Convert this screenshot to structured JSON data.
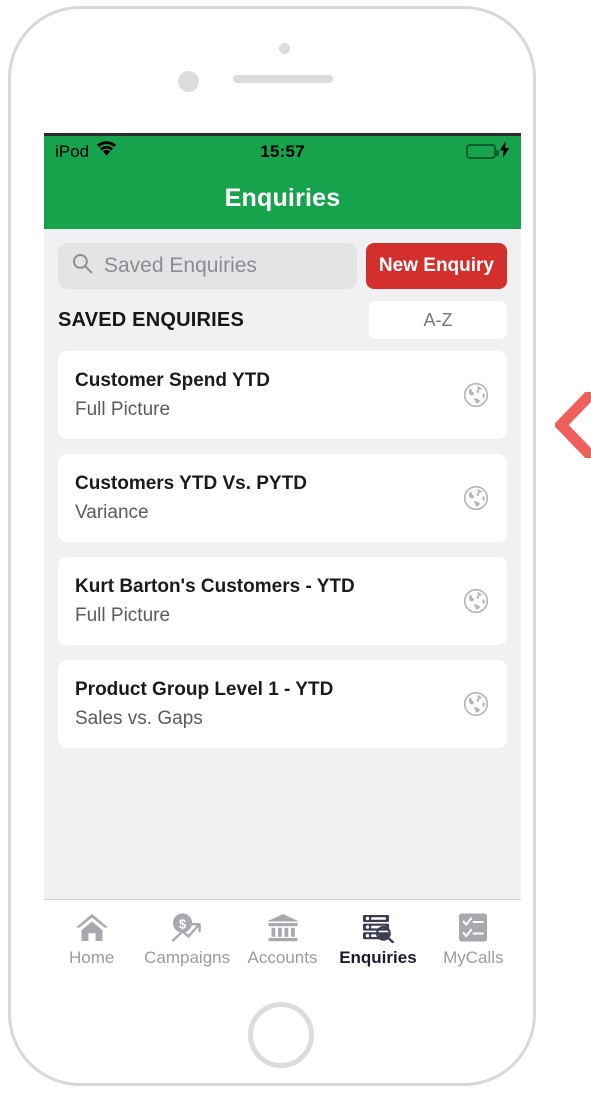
{
  "theme": {
    "brand_green": "#17a24c",
    "accent_red": "#d32f2c",
    "chevron_color": "#ee5f5b",
    "screen_background": "#f1f1f4",
    "card_background": "#ffffff",
    "icon_gray": "#a8a8ae",
    "active_tab_color": "#1b1b2e"
  },
  "status_bar": {
    "carrier": "iPod",
    "wifi_icon": "wifi-icon",
    "time": "15:57",
    "battery_icon": "battery-icon",
    "charging_icon": "lightning-bolt-icon"
  },
  "nav_bar": {
    "title": "Enquiries"
  },
  "search": {
    "icon": "search-icon",
    "placeholder": "Saved Enquiries",
    "value": ""
  },
  "new_enquiry_button": {
    "label": "New Enquiry"
  },
  "section": {
    "title": "SAVED ENQUIRIES",
    "sort_label": "A-Z"
  },
  "enquiries": [
    {
      "title": "Customer Spend YTD",
      "subtitle": "Full Picture",
      "icon": "globe-icon"
    },
    {
      "title": "Customers YTD Vs. PYTD",
      "subtitle": "Variance",
      "icon": "globe-icon"
    },
    {
      "title": "Kurt Barton's Customers - YTD",
      "subtitle": "Full Picture",
      "icon": "globe-icon"
    },
    {
      "title": "Product Group Level 1 - YTD",
      "subtitle": "Sales vs. Gaps",
      "icon": "globe-icon"
    }
  ],
  "tab_bar": {
    "active": "Enquiries",
    "tabs": [
      {
        "label": "Home",
        "icon": "home-icon",
        "active": false
      },
      {
        "label": "Campaigns",
        "icon": "dollar-growth-icon",
        "active": false
      },
      {
        "label": "Accounts",
        "icon": "bank-icon",
        "active": false
      },
      {
        "label": "Enquiries",
        "icon": "list-search-icon",
        "active": true
      },
      {
        "label": "MyCalls",
        "icon": "checklist-icon",
        "active": false
      }
    ]
  },
  "decoration": {
    "chevron_left_icon": "chevron-left-icon"
  }
}
